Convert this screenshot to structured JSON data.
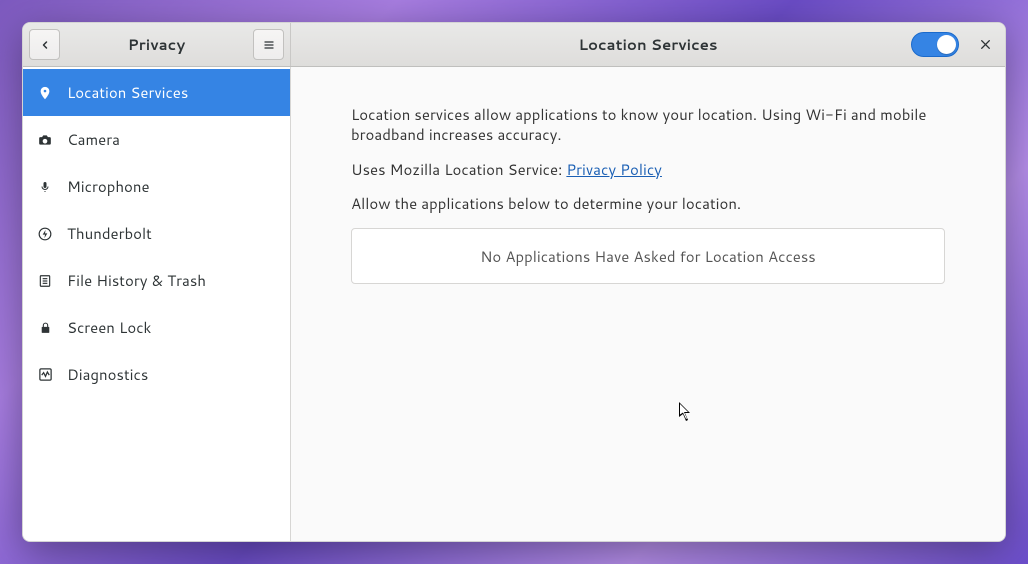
{
  "header": {
    "left_title": "Privacy",
    "right_title": "Location Services"
  },
  "toggle": {
    "on": true
  },
  "sidebar": {
    "items": [
      {
        "label": "Location Services",
        "selected": true,
        "icon": "location"
      },
      {
        "label": "Camera",
        "selected": false,
        "icon": "camera"
      },
      {
        "label": "Microphone",
        "selected": false,
        "icon": "microphone"
      },
      {
        "label": "Thunderbolt",
        "selected": false,
        "icon": "thunderbolt"
      },
      {
        "label": "File History & Trash",
        "selected": false,
        "icon": "filehistory"
      },
      {
        "label": "Screen Lock",
        "selected": false,
        "icon": "lock"
      },
      {
        "label": "Diagnostics",
        "selected": false,
        "icon": "diagnostics"
      }
    ]
  },
  "content": {
    "para1": "Location services allow applications to know your location. Using Wi-Fi and mobile broadband increases accuracy.",
    "para2_pre": "Uses Mozilla Location Service: ",
    "para2_link": "Privacy Policy",
    "para3": "Allow the applications below to determine your location.",
    "empty_apps": "No Applications Have Asked for Location Access"
  }
}
